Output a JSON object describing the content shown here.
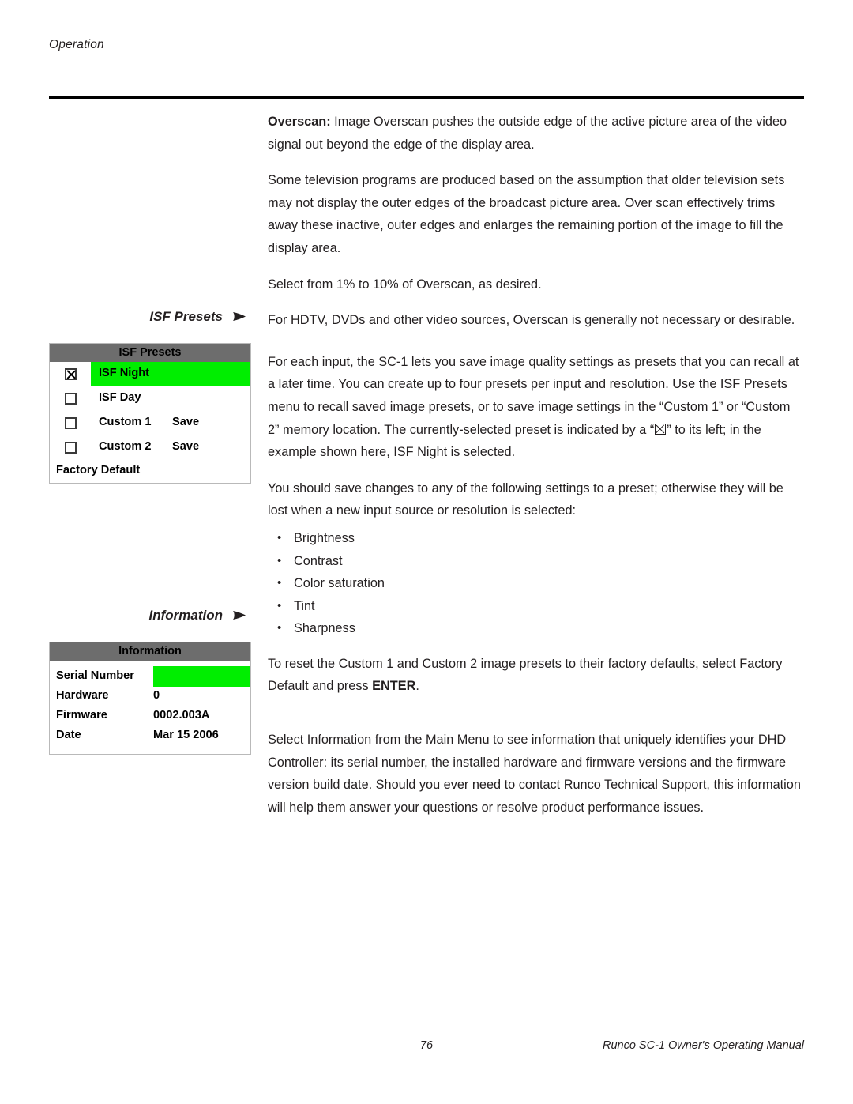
{
  "page": {
    "running_header": "Operation",
    "footer_page_number": "76",
    "footer_manual_title": "Runco SC-1 Owner's Operating Manual",
    "accent_green": "#00ee00",
    "menu_title_gray": "#6d6d6d",
    "text_color": "#231f20"
  },
  "body": {
    "overscan_label": "Overscan:",
    "p_overscan": " Image Overscan pushes the outside edge of the active picture area of the video signal out beyond the edge of the display area.",
    "p_television": "Some television programs are produced based on the assumption that older television sets may not display the outer edges of the broadcast picture area. Over scan effectively trims away these inactive, outer edges and enlarges the remaining portion of the image to fill the display area.",
    "p_select_range": "Select from 1% to 10% of Overscan, as desired.",
    "p_hdtv": "For HDTV, DVDs and other video sources, Overscan is generally not necessary or desirable.",
    "p_isf_presets_a": "For each input, the SC-1 lets you save image quality settings as presets that you can recall at a later time. You can create up to four presets per input and resolution. Use the ISF Presets menu to recall saved image presets, or to save image settings in the “Custom 1” or “Custom 2” memory location. The currently-selected preset is indicated by a “",
    "p_isf_presets_b": "” to its left; in the example shown here, ISF Night is selected.",
    "p_save_changes": "You should save changes to any of the following settings to a preset; otherwise they will be lost when a new input source or resolution is selected:",
    "settings_bullets": [
      "Brightness",
      "Contrast",
      "Color saturation",
      "Tint",
      "Sharpness"
    ],
    "p_reset_a": "To reset the Custom 1 and Custom 2 image presets to their factory defaults, select Factory Default and press ",
    "p_reset_enter": "ENTER",
    "p_reset_b": ".",
    "p_information": "Select Information from the Main Menu to see information that uniquely identifies your DHD Controller: its serial number, the installed hardware and firmware versions and the firmware version build date. Should you ever need to contact Runco Technical Support, this information will help them answer your questions or resolve product performance issues."
  },
  "side_headings": {
    "isf_presets": "ISF Presets",
    "information": "Information",
    "arrow_glyph": "➤"
  },
  "isf_menu": {
    "title": "ISF Presets",
    "rows": [
      {
        "label": "ISF Night",
        "checked": true,
        "highlighted": true,
        "action": ""
      },
      {
        "label": "ISF Day",
        "checked": false,
        "highlighted": false,
        "action": ""
      },
      {
        "label": "Custom 1",
        "checked": false,
        "highlighted": false,
        "action": "Save"
      },
      {
        "label": "Custom 2",
        "checked": false,
        "highlighted": false,
        "action": "Save"
      }
    ],
    "footer_item": "Factory Default"
  },
  "information_menu": {
    "title": "Information",
    "rows": [
      {
        "key": "Serial Number",
        "value": "",
        "highlighted": true
      },
      {
        "key": "Hardware",
        "value": "0",
        "highlighted": false
      },
      {
        "key": "Firmware",
        "value": "0002.003A",
        "highlighted": false
      },
      {
        "key": "Date",
        "value": "Mar 15 2006",
        "highlighted": false
      }
    ]
  }
}
